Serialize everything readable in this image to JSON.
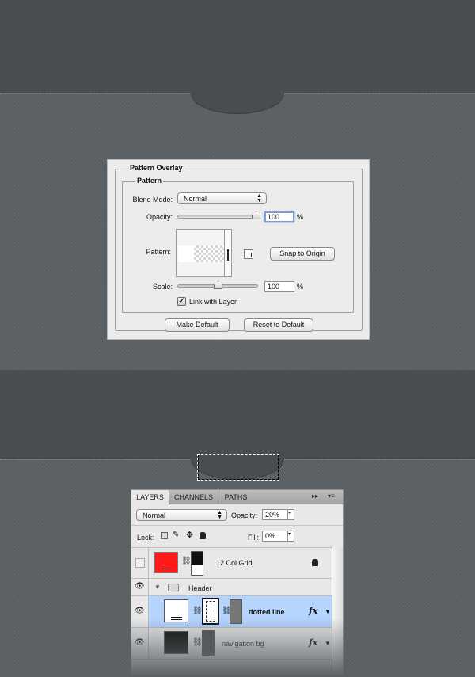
{
  "pattern_overlay": {
    "title": "Pattern Overlay",
    "group_title": "Pattern",
    "blend_mode_label": "Blend Mode:",
    "blend_mode_value": "Normal",
    "opacity_label": "Opacity:",
    "opacity_value": "100",
    "opacity_slider_level": 100,
    "percent_sign": "%",
    "pattern_label": "Pattern:",
    "snap_button": "Snap to Origin",
    "scale_label": "Scale:",
    "scale_value": "100",
    "scale_slider_level": 50,
    "link_checkbox_label": "Link with Layer",
    "link_checked": true,
    "check_glyph": "✓",
    "make_default_button": "Make Default",
    "reset_default_button": "Reset to Default"
  },
  "layers_panel": {
    "tabs": [
      "LAYERS",
      "CHANNELS",
      "PATHS"
    ],
    "active_tab": "LAYERS",
    "collapse_glyph": "▸▸",
    "menu_glyph": "▾≡",
    "blend_mode_value": "Normal",
    "opacity_label": "Opacity:",
    "opacity_value": "20%",
    "lock_label": "Lock:",
    "fill_label": "Fill:",
    "fill_value": "0%",
    "layers": [
      {
        "name": "12 Col Grid",
        "visible": false,
        "locked": true,
        "thumb_color": "#ff1a1a"
      },
      {
        "name": "Header",
        "type": "group",
        "visible": true,
        "expanded": true
      },
      {
        "name": "dotted line",
        "visible": true,
        "selected": true,
        "fx": "fx"
      },
      {
        "name": "navigation bg",
        "visible": true,
        "fx": "fx"
      }
    ],
    "eye_glyph": "👁",
    "lock_glyph": "🔒",
    "group_arrow": "▼"
  },
  "colors": {
    "background_light": "#5a6064",
    "band_dark": "#474d51",
    "selection_blue": "#b5d5ff",
    "swatch_red": "#ff1a1a"
  }
}
